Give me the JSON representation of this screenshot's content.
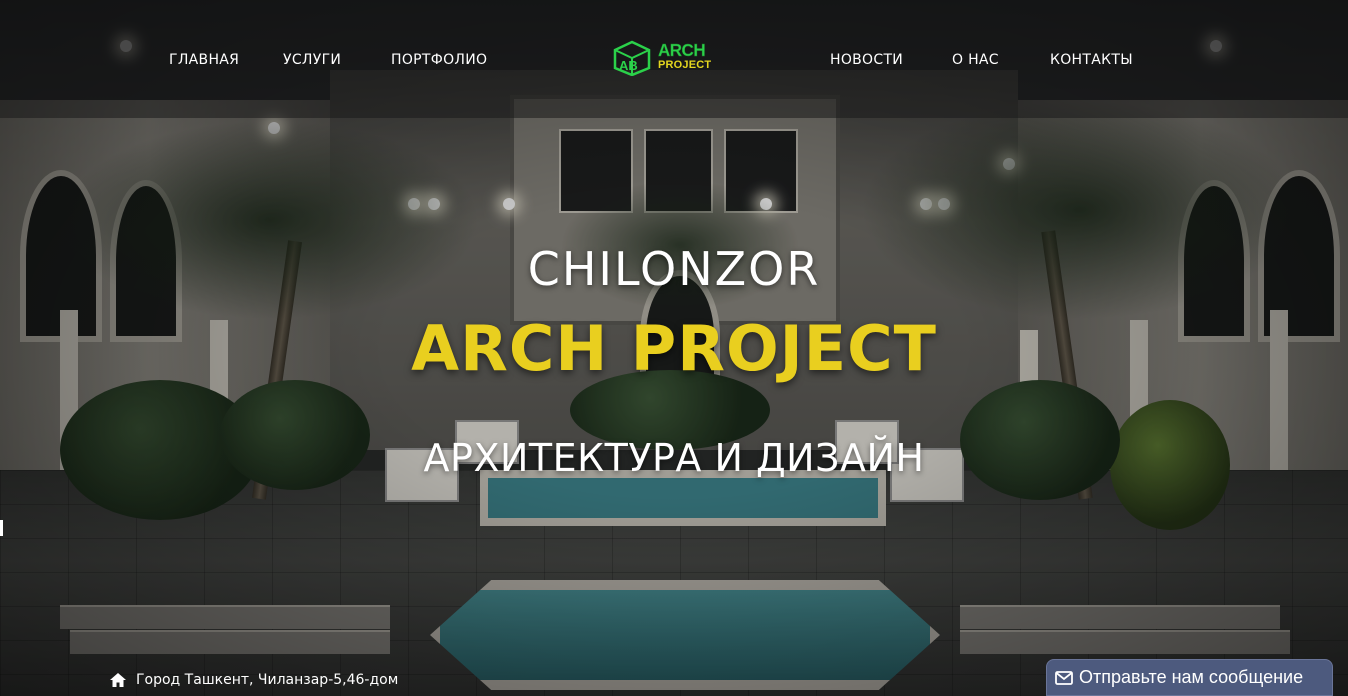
{
  "header": {
    "nav_left": [
      "ГЛАВНАЯ",
      "УСЛУГИ",
      "ПОРТФОЛИО"
    ],
    "nav_right": [
      "НОВОСТИ",
      "О НАС",
      "КОНТАКТЫ"
    ],
    "logo": {
      "monogram": "AB",
      "line1": "ARCH",
      "line2": "PROJECT"
    }
  },
  "hero": {
    "subtitle_top": "CHILONZOR",
    "title": "ARCH PROJECT",
    "subtitle_bottom": "АРХИТЕКТУРА И ДИЗАЙН"
  },
  "footer": {
    "address": "Город Ташкент, Чиланзар-5,46-дом",
    "address_icon": "home-icon"
  },
  "contact_button": {
    "label": "Отправьте нам сообщение",
    "icon": "envelope-icon"
  },
  "colors": {
    "title_yellow": "#e9cf1f",
    "logo_green": "#2bd14a",
    "button_bg": "#4d5a7e"
  }
}
